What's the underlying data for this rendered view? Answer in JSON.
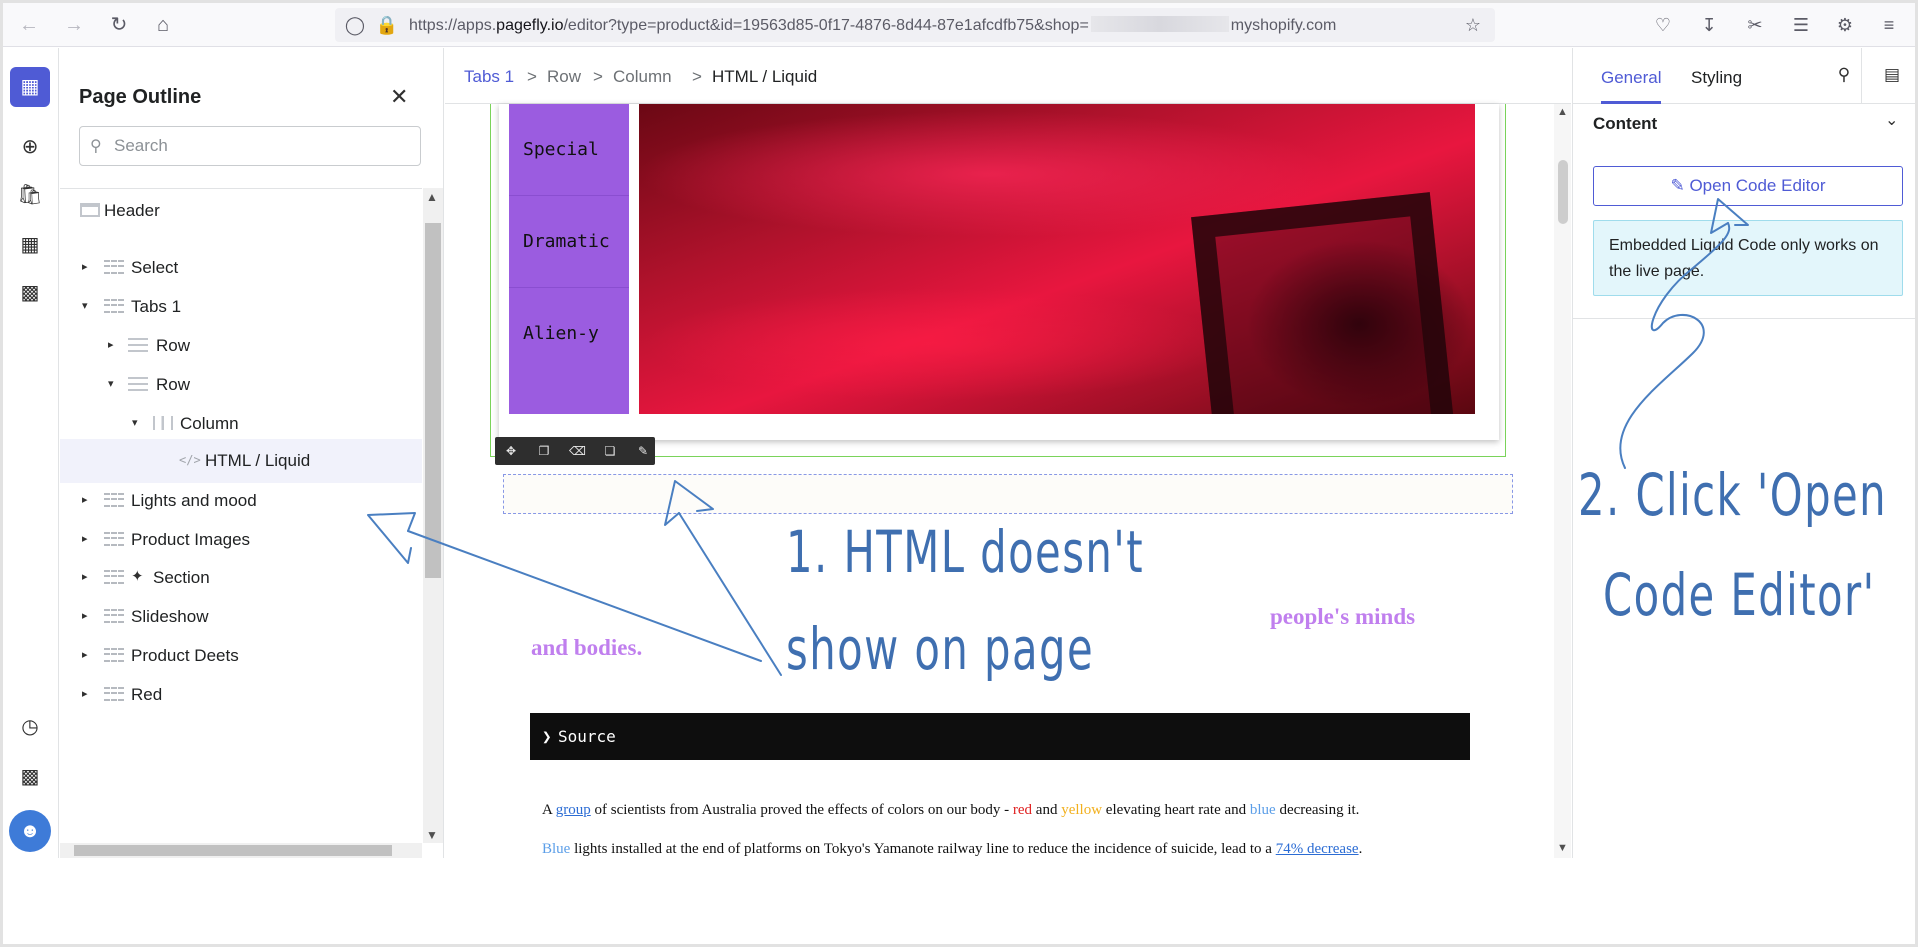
{
  "browser": {
    "url_prefix": "https://apps.",
    "url_domain": "pagefly.io",
    "url_path": "/editor?type=product&id=19563d85-0f17-4876-8d44-87e1afcdfb75&shop=",
    "url_suffix": "myshopify.com"
  },
  "outline": {
    "title": "Page Outline",
    "search_placeholder": "Search",
    "items": [
      {
        "label": "Header"
      },
      {
        "label": "Select"
      },
      {
        "label": "Tabs 1"
      },
      {
        "label": "Row"
      },
      {
        "label": "Row"
      },
      {
        "label": "Column"
      },
      {
        "label": "HTML / Liquid"
      },
      {
        "label": "Lights and mood"
      },
      {
        "label": "Product Images"
      },
      {
        "label": "Section"
      },
      {
        "label": "Slideshow"
      },
      {
        "label": "Product Deets"
      },
      {
        "label": "Red"
      }
    ]
  },
  "breadcrumb": {
    "items": [
      "Tabs 1",
      "Row",
      "Column",
      "HTML / Liquid"
    ],
    "separator": ">"
  },
  "canvas": {
    "tabs": [
      "Special",
      "Dramatic",
      "Alien-y"
    ],
    "text_left": "and bodies.",
    "text_right": "people's minds",
    "source_label": "Source",
    "para1": {
      "a": "A ",
      "link": "group",
      "b": " of scientists from Australia proved the effects of colors on our body - ",
      "red": "red",
      "and": " and ",
      "yellow": "yellow",
      "c": " elevating heart rate and ",
      "blue": "blue",
      "d": " decreasing it."
    },
    "para2": {
      "blue": "Blue",
      "a": " lights installed at the end of platforms on Tokyo's Yamanote railway line to reduce the incidence of suicide, lead to a ",
      "link": "74% decrease",
      "end": "."
    }
  },
  "right_panel": {
    "tab_general": "General",
    "tab_styling": "Styling",
    "section_title": "Content",
    "open_code_editor": "Open Code Editor",
    "note": "Embedded Liquid Code only works on the live page."
  },
  "annotations": {
    "note1_line1": "1. HTML doesn't",
    "note1_line2": "show on page",
    "note2_line1": "2. Click 'Open",
    "note2_line2": "Code Editor'"
  },
  "colors": {
    "accent": "#4f5bd5",
    "tab_purple": "#9b5ce0",
    "annotation_blue": "#3f6fb0"
  }
}
